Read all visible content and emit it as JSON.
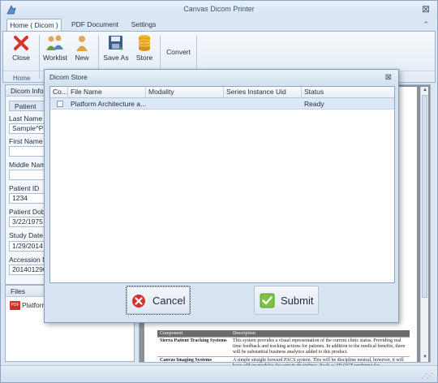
{
  "window": {
    "title": "Canvas Dicom Printer"
  },
  "ribbon_tabs": [
    {
      "label": "Home ( Dicom )"
    },
    {
      "label": "PDF Document"
    },
    {
      "label": "Settings"
    }
  ],
  "ribbon": {
    "buttons": [
      {
        "label": "Close",
        "icon": "close-x-icon"
      },
      {
        "label": "Worklist",
        "icon": "people-icon"
      },
      {
        "label": "New",
        "icon": "person-icon"
      },
      {
        "label": "Save As",
        "icon": "floppy-icon"
      },
      {
        "label": "Store",
        "icon": "database-icon"
      },
      {
        "label": "Convert",
        "icon": ""
      }
    ],
    "group_label": "Home"
  },
  "left_panel": {
    "header": "Dicom Information",
    "tab": "Patient",
    "fields": [
      {
        "label": "Last Name",
        "value": "Sample^Patient"
      },
      {
        "label": "First Name",
        "value": ""
      },
      {
        "label": "Middle Name",
        "value": ""
      },
      {
        "label": "Patient ID",
        "value": "1234"
      },
      {
        "label": "Patient Dob",
        "value": "3/22/1975"
      },
      {
        "label": "Study Date",
        "value": "1/29/2014"
      },
      {
        "label": "Accession Number",
        "value": "20140129030"
      }
    ]
  },
  "files_panel": {
    "header": "Files",
    "items": [
      {
        "name": "Platform Architecture"
      }
    ]
  },
  "document": {
    "table_headers": [
      "Component",
      "Description"
    ],
    "rows": [
      {
        "component": "Sierra Patient Tracking Systems",
        "description": "This system provides a visual representation of the current clinic status. Providing real time feedback and tracking actions for patients. In addition to the medical benefits, there will be substantial business analytics added to this product."
      },
      {
        "component": "Canvas Imaging Systems",
        "description": "A simple straight forward PACS system. This will be discipline neutral, however, it will have add on modules for certain disciplines. Such as 3D OCT rendering for"
      }
    ]
  },
  "dialog": {
    "title": "Dicom Store",
    "columns": [
      "Co...",
      "File Name",
      "Modality",
      "Series Instance Uid",
      "Status"
    ],
    "rows": [
      {
        "checked": false,
        "file_name": "Platform Architecture a...",
        "modality": "",
        "series_uid": "",
        "status": "Ready"
      }
    ],
    "cancel_label": "Cancel",
    "submit_label": "Submit"
  },
  "colors": {
    "accent": "#dce8f6",
    "cancel_icon": "#d9312b",
    "submit_icon": "#7cc342"
  }
}
